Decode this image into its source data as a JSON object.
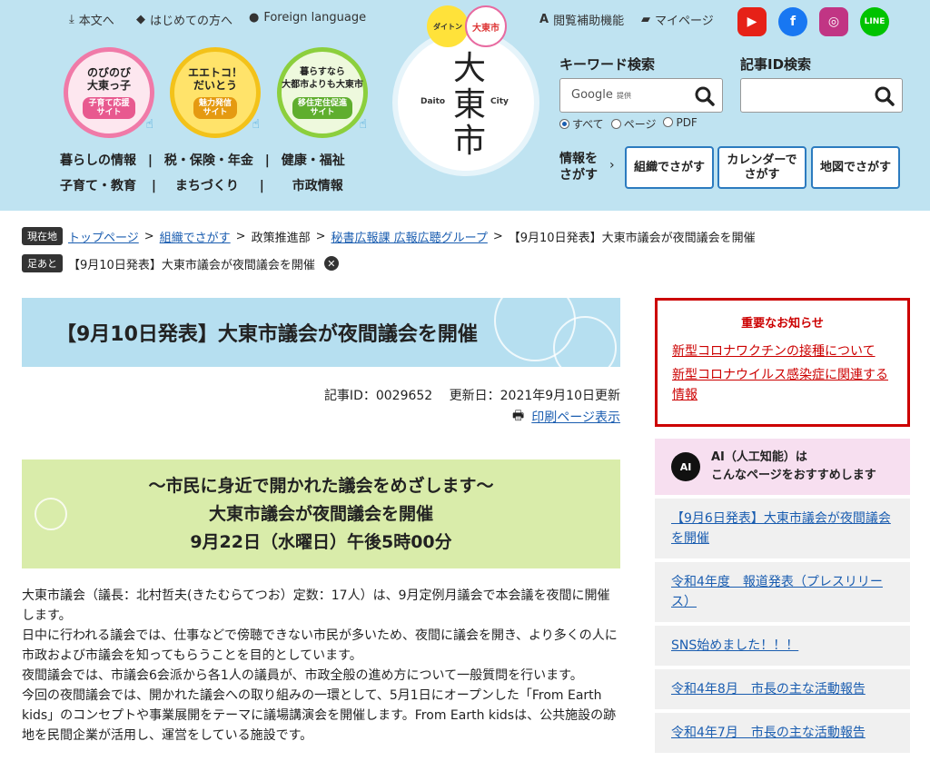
{
  "header": {
    "utility": [
      {
        "icon": "download-icon",
        "label": "本文へ"
      },
      {
        "icon": "beginner-mark-icon",
        "label": "はじめての方へ"
      },
      {
        "icon": "globe-icon",
        "label": "Foreign language"
      }
    ],
    "banners": [
      {
        "title": "のびのび\n大東っ子",
        "sub": "子育て応援\nサイト",
        "ring": "#f07aa8",
        "sub_bg": "#e8598f",
        "fill": "#fde7ef"
      },
      {
        "title": "エエトコ！\nだいとう",
        "sub": "魅力発信\nサイト",
        "ring": "#f3c21a",
        "sub_bg": "#e59a11",
        "fill": "#ffe36a"
      },
      {
        "title": "暮らすなら\n大都市よりも大東市",
        "sub": "移住定住促進\nサイト",
        "ring": "#8ccf3d",
        "sub_bg": "#5fae2e",
        "fill": "#eef9dd"
      }
    ],
    "nav_row1": [
      "暮らしの情報",
      "税・保険・年金",
      "健康・福祉"
    ],
    "nav_row2": [
      "子育て・教育",
      "まちづくり",
      "市政情報"
    ],
    "logo": {
      "kanji": "大東市",
      "left": "Daito",
      "right": "City",
      "mascot_left": "ダイトン",
      "mascot_right": "大東市"
    },
    "access_label": "閲覧補助機能",
    "mypage_label": "マイページ",
    "sns": [
      {
        "name": "youtube-icon",
        "color": "#e62117",
        "glyph": "▶"
      },
      {
        "name": "facebook-icon",
        "color": "#1877f2",
        "glyph": "f"
      },
      {
        "name": "instagram-icon",
        "color": "#c13584",
        "glyph": "◎"
      },
      {
        "name": "line-icon",
        "color": "#00c300",
        "glyph": "LINE"
      }
    ],
    "keyword_search": {
      "heading": "キーワード検索",
      "placeholder": "Google",
      "placeholder_small": "提供"
    },
    "article_search": {
      "heading": "記事ID検索",
      "placeholder": ""
    },
    "scope_options": [
      "すべて",
      "ページ",
      "PDF"
    ],
    "scope_selected": "すべて",
    "find_label": "情報を\nさがす",
    "find_buttons": [
      "組織でさがす",
      "カレンダーで\nさがす",
      "地図でさがす"
    ]
  },
  "breadcrumb": {
    "tag": "現在地",
    "links": [
      "トップページ",
      "組織でさがす"
    ],
    "plain": "政策推進部",
    "link3": "秘書広報課 広報広聴グループ",
    "current": "【9月10日発表】大東市議会が夜間議会を開催",
    "sep": ">"
  },
  "footprint": {
    "tag": "足あと",
    "item": "【9月10日発表】大東市議会が夜間議会を開催"
  },
  "article": {
    "title": "【9月10日発表】大東市議会が夜間議会を開催",
    "meta": "記事ID：0029652　 更新日：2021年9月10日更新",
    "print_label": "印刷ページ表示",
    "highlight": [
      "～市民に身近で開かれた議会をめざします～",
      "大東市議会が夜間議会を開催",
      "9月22日（水曜日）午後5時00分"
    ],
    "body": [
      "大東市議会（議長：北村哲夫(きたむらてつお）定数：17人）は、9月定例月議会で本会議を夜間に開催します。",
      "日中に行われる議会では、仕事などで傍聴できない市民が多いため、夜間に議会を開き、より多くの人に市政および市議会を知ってもらうことを目的としています。",
      "夜間議会では、市議会6会派から各1人の議員が、市政全般の進め方について一般質問を行います。",
      "今回の夜間議会では、開かれた議会への取り組みの一環として、5月1日にオープンした「From Earth kids」のコンセプトや事業展開をテーマに議場講演会を開催します。From Earth kidsは、公共施設の跡地を民間企業が活用し、運営をしている施設です。"
    ]
  },
  "sidebar": {
    "notice_title": "重要なお知らせ",
    "notice_links": [
      "新型コロナワクチンの接種について",
      "新型コロナウイルス感染症に関連する情報"
    ],
    "ai_icon": "AI",
    "ai_heading": "AI（人工知能）は\nこんなページをおすすめします",
    "recommendations": [
      "【9月6日発表】大東市議会が夜間議会を開催",
      "令和4年度　報道発表（プレスリリース）",
      "SNS始めました！！！",
      "令和4年8月　市長の主な活動報告",
      "令和4年7月　市長の主な活動報告"
    ]
  }
}
